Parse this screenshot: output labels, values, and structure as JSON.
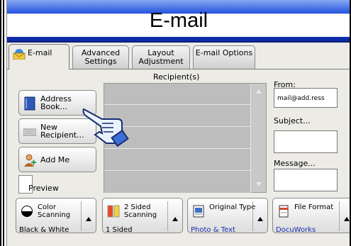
{
  "window": {
    "title": "E-mail"
  },
  "tabs": [
    {
      "label": "E-mail",
      "active": true,
      "icon": "email-icon"
    },
    {
      "label": "Advanced Settings"
    },
    {
      "label": "Layout Adjustment"
    },
    {
      "label": "E-mail Options"
    }
  ],
  "recipients": {
    "header": "Recipient(s)",
    "rows": [
      "",
      "",
      "",
      "",
      ""
    ]
  },
  "left_buttons": {
    "address_book": {
      "label_line1": "Address",
      "label_line2": "Book...",
      "icon": "address-book-icon"
    },
    "new_recipient": {
      "label_line1": "New",
      "label_line2": "Recipient...",
      "icon": "keyboard-icon"
    },
    "add_me": {
      "label": "Add Me",
      "icon": "add-person-icon"
    },
    "preview": {
      "label": "Preview"
    }
  },
  "right_panel": {
    "from_label": "From:",
    "from_value": "mail@add.ress",
    "subject_label": "Subject...",
    "subject_value": "",
    "message_label": "Message...",
    "message_value": ""
  },
  "bottom_buttons": [
    {
      "label_line1": "Color",
      "label_line2": "Scanning",
      "value": "Black & White",
      "icon": "color-scanning-icon",
      "value_color": "#000000"
    },
    {
      "label_line1": "2 Sided",
      "label_line2": "Scanning",
      "value": "1 Sided",
      "icon": "two-sided-icon",
      "value_color": "#000000"
    },
    {
      "label_line1": "Original Type",
      "label_line2": "",
      "value": "Photo & Text",
      "icon": "original-type-icon",
      "value_color": "#1a2fb0"
    },
    {
      "label_line1": "File Format",
      "label_line2": "",
      "value": "DocuWorks",
      "icon": "file-format-icon",
      "value_color": "#1a2fb0"
    }
  ],
  "colors": {
    "title_gradient_top": "#86a8f0",
    "title_gradient_bottom": "#0d2aa3",
    "panel_bg": "#ecebe6",
    "recipient_bg": "#bdbdbd"
  }
}
